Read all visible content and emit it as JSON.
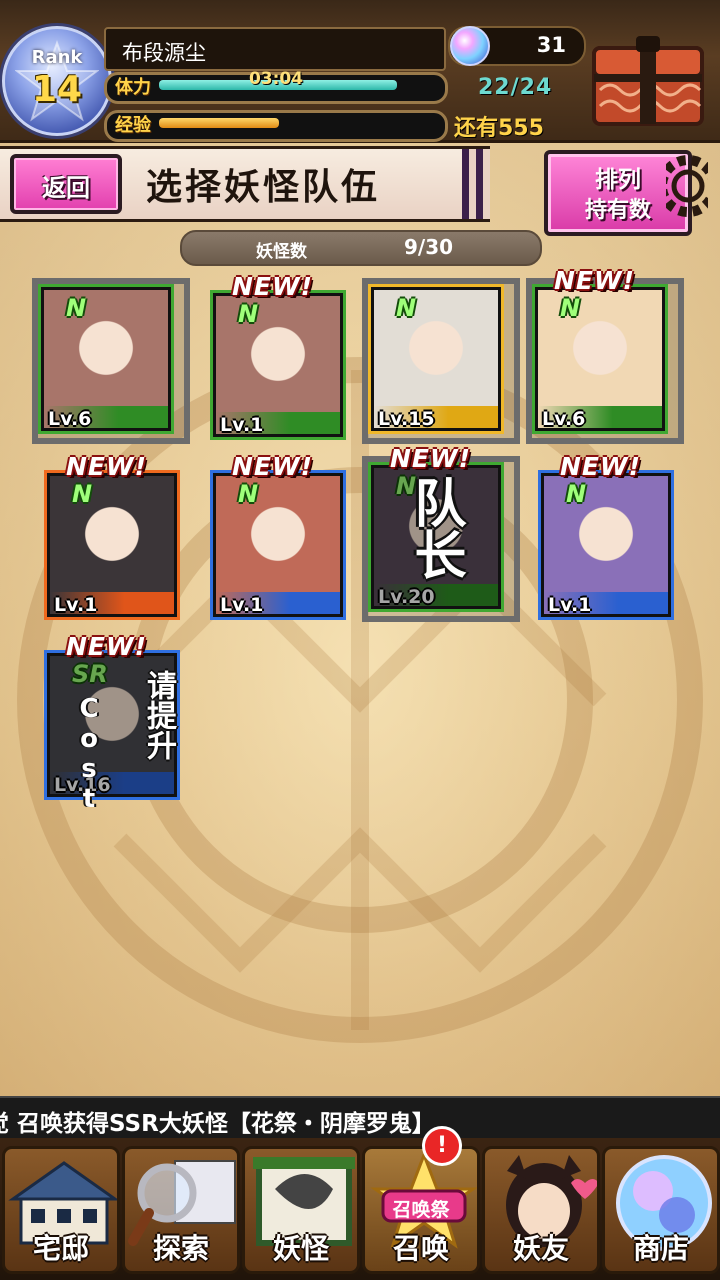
{
  "header": {
    "rank_label": "Rank",
    "rank_value": "14",
    "player_name": "布段源尘",
    "stamina_label": "体力",
    "stamina_timer": "03:04",
    "stamina_value": "22/24",
    "stamina_fill": 0.917,
    "exp_label": "经验",
    "exp_fill": 0.46,
    "exp_remaining": "还有555",
    "crystal_count": "31"
  },
  "title_bar": {
    "back_label": "返回",
    "title": "选择妖怪队伍",
    "sort_line1": "排列",
    "sort_line2": "持有数"
  },
  "counter": {
    "label": "妖怪数",
    "value": "9/30"
  },
  "cards": [
    {
      "level": "Lv.6",
      "rarity": "N",
      "new": "",
      "border": "#3fa832",
      "bar": "#2f8c25",
      "selected": true,
      "art": "#a8756a"
    },
    {
      "level": "Lv.1",
      "rarity": "N",
      "new": "NEW!",
      "border": "#3fa832",
      "bar": "#2f8c25",
      "selected": false,
      "art": "#a8756a"
    },
    {
      "level": "Lv.15",
      "rarity": "N",
      "new": "",
      "border": "#f0b82a",
      "bar": "#e0a814",
      "selected": true,
      "art": "#e2ddd5"
    },
    {
      "level": "Lv.6",
      "rarity": "N",
      "new": "NEW!",
      "border": "#3fa832",
      "bar": "#2f8c25",
      "selected": true,
      "art": "#f1d8b4"
    },
    {
      "level": "Lv.1",
      "rarity": "N",
      "new": "NEW!",
      "border": "#ef6a1e",
      "bar": "#e0551a",
      "selected": false,
      "art": "#3b3538"
    },
    {
      "level": "Lv.1",
      "rarity": "N",
      "new": "NEW!",
      "border": "#2f6fe0",
      "bar": "#2a60d0",
      "selected": false,
      "art": "#c06a58"
    },
    {
      "level": "Lv.20",
      "rarity": "N",
      "new": "NEW!",
      "border": "#3fa832",
      "bar": "#2f8c25",
      "selected": true,
      "art": "#5a4a5a",
      "leader_text": "队长"
    },
    {
      "level": "Lv.1",
      "rarity": "N",
      "new": "NEW!",
      "border": "#2f6fe0",
      "bar": "#2a60d0",
      "selected": false,
      "art": "#8a70b8"
    },
    {
      "level": "Lv.16",
      "rarity": "SR",
      "new": "NEW!",
      "border": "#2f6fe0",
      "bar": "#2a60d0",
      "selected": false,
      "art": "#4a4a50",
      "cost_text": "请提升",
      "cost_word": "Cost"
    }
  ],
  "ticker": "觉 召唤获得SSR大妖怪【花祭・阴摩罗鬼】",
  "nav": [
    {
      "label": "宅邸",
      "icon": "house-icon"
    },
    {
      "label": "探索",
      "icon": "magnifier-icon"
    },
    {
      "label": "妖怪",
      "icon": "scroll-icon"
    },
    {
      "label": "召唤",
      "icon": "summon-icon",
      "badge": "召唤祭"
    },
    {
      "label": "妖友",
      "icon": "friend-icon"
    },
    {
      "label": "商店",
      "icon": "orb-icon"
    }
  ],
  "nav_alert": "!"
}
